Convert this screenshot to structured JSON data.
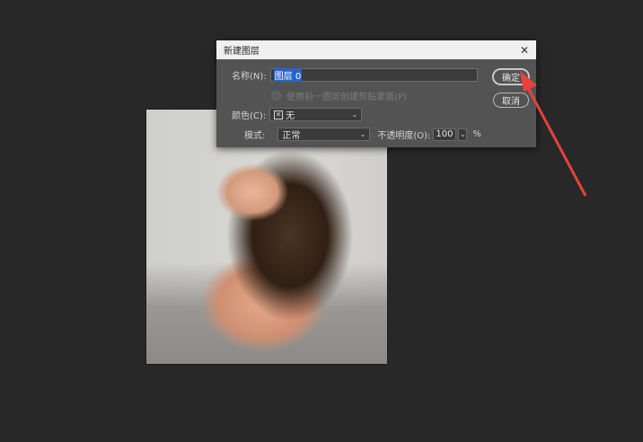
{
  "dialog": {
    "title": "新建图层",
    "name_label": "名称(N):",
    "name_value": "图层 0",
    "clip_checkbox_label": "使用前一图层创建剪贴蒙版(P)",
    "color_label": "颜色(C):",
    "color_icon_glyph": "✕",
    "color_value": "无",
    "mode_label": "模式:",
    "mode_value": "正常",
    "opacity_label": "不透明度(O):",
    "opacity_value": "100",
    "opacity_unit": "%",
    "ok_label": "确定",
    "cancel_label": "取消"
  },
  "icons": {
    "close": "close-icon",
    "dropdown": "chevron-down-icon",
    "color_swatch": "no-color-x-icon"
  },
  "colors": {
    "arrow": "#e8413a",
    "selection": "#2a64c9",
    "dialog_bg": "#535353",
    "workspace_bg": "#282828"
  }
}
